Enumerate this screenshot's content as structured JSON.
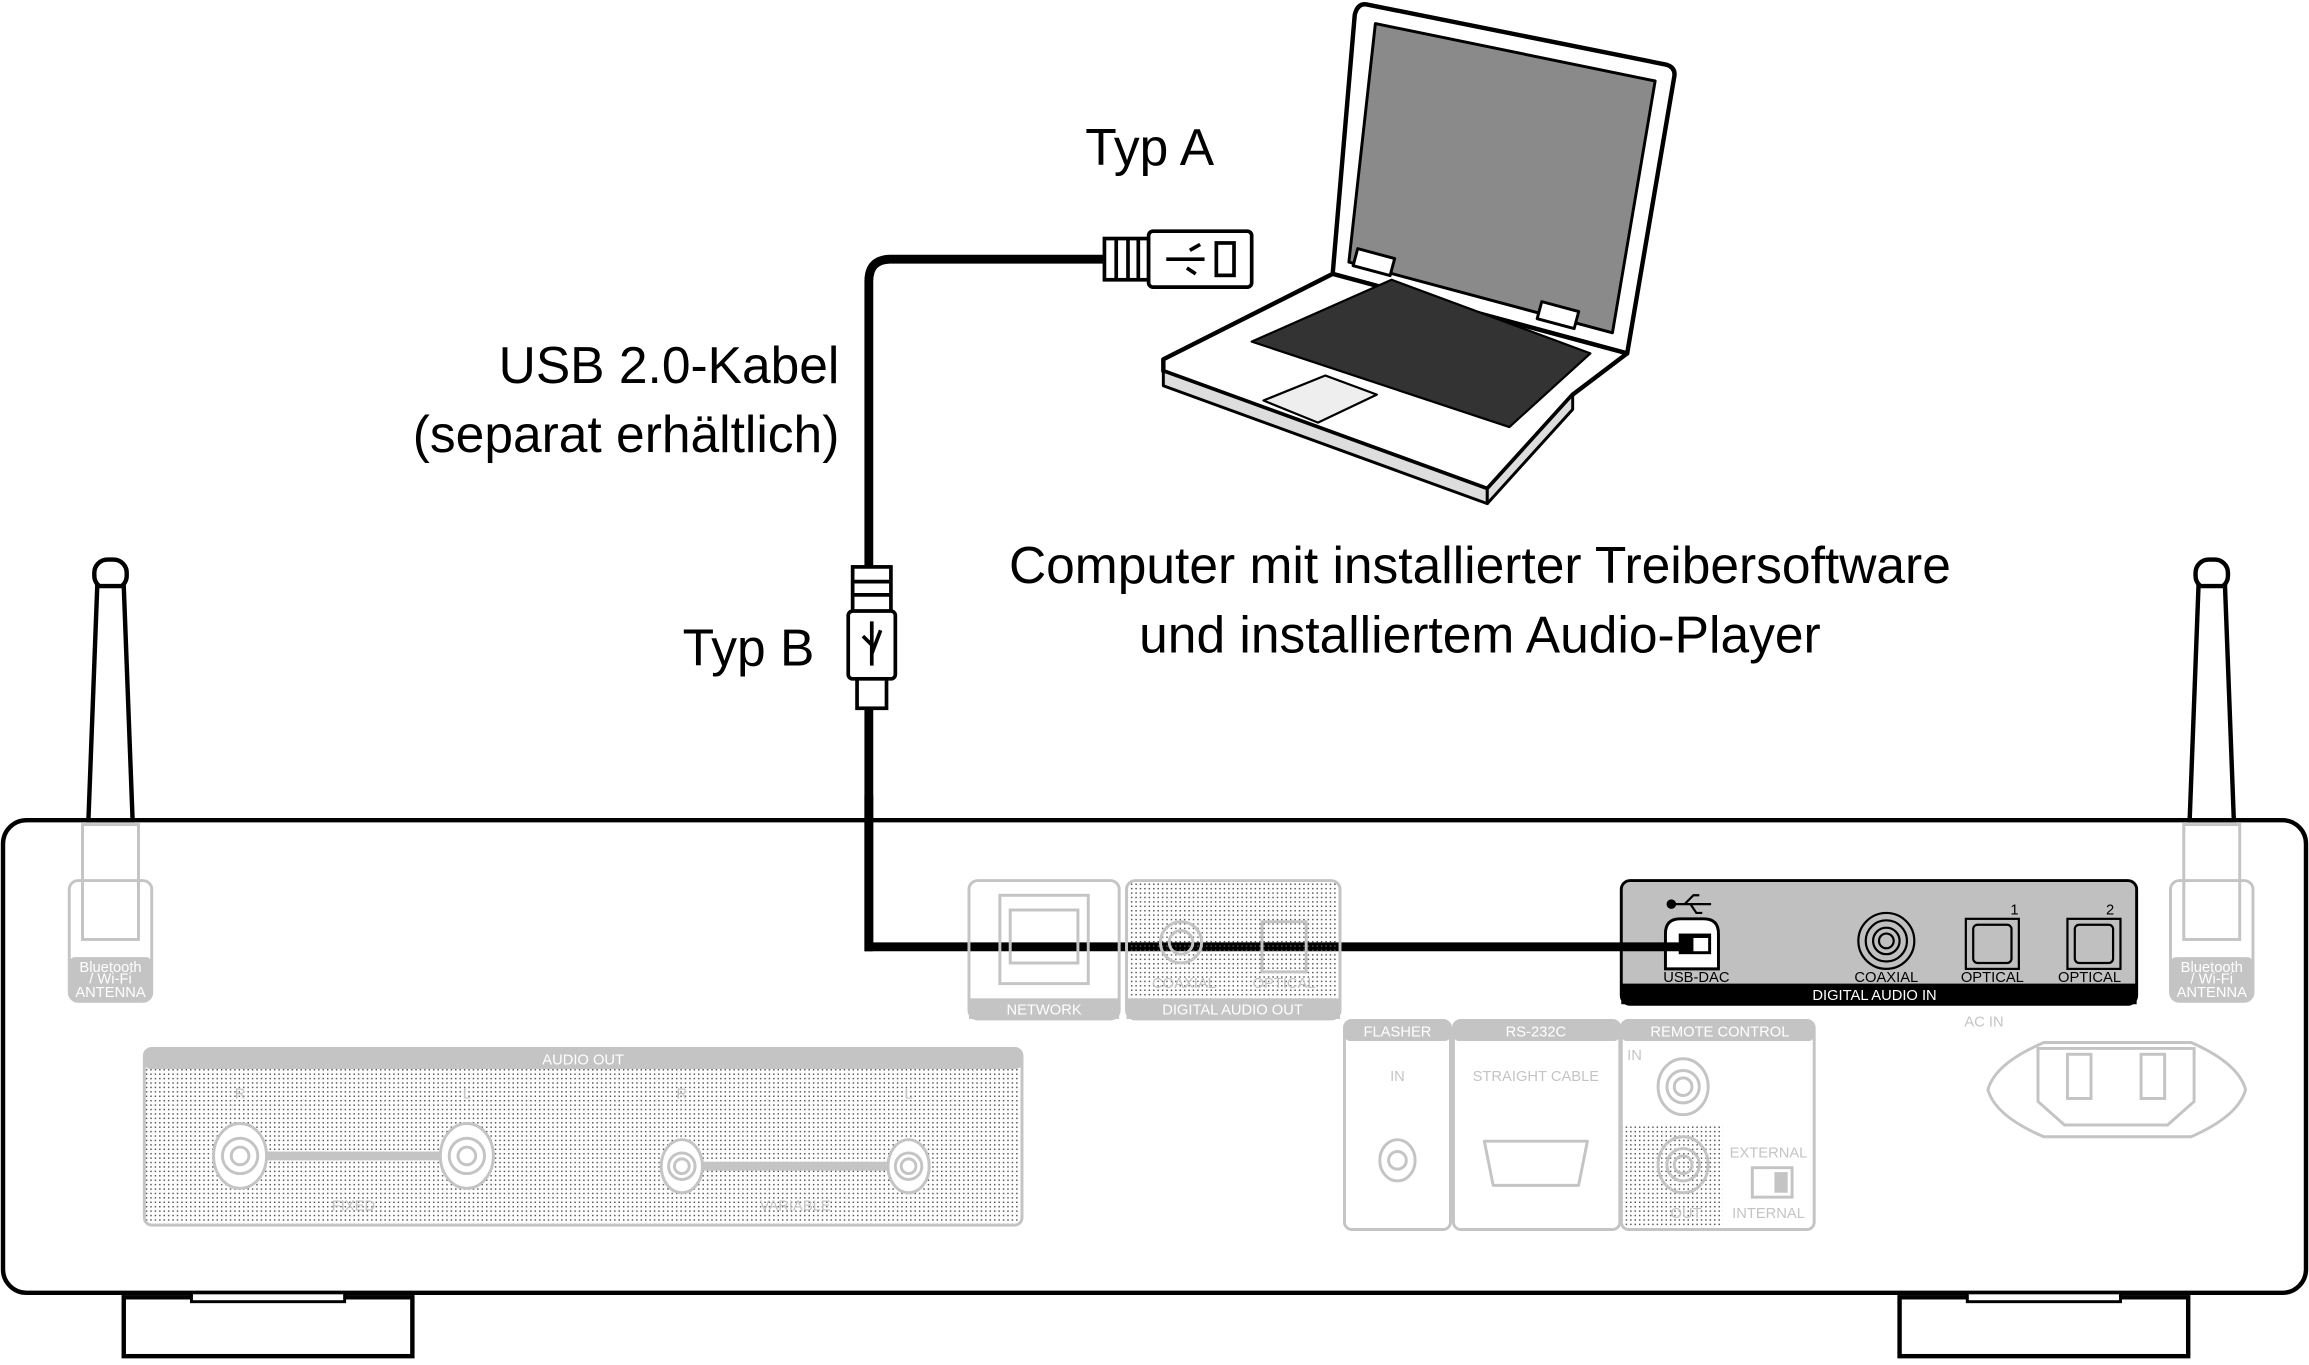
{
  "labels": {
    "typ_a": "Typ A",
    "typ_b": "Typ B",
    "cable_line1": "USB 2.0-Kabel",
    "cable_line2": "(separat erhältlich)",
    "computer_line1": "Computer mit installierter Treibersoftware",
    "computer_line2": "und installiertem Audio-Player"
  },
  "panel": {
    "antenna": [
      "Bluetooth",
      "/ Wi-Fi",
      "ANTENNA"
    ],
    "network": "NETWORK",
    "digital_audio_out": {
      "title": "DIGITAL AUDIO OUT",
      "coaxial": "COAXIAL",
      "optical": "OPTICAL"
    },
    "digital_audio_in": {
      "title": "DIGITAL AUDIO IN",
      "usb_dac": "USB-DAC",
      "coaxial": "COAXIAL",
      "optical1": "OPTICAL",
      "optical2": "OPTICAL",
      "num1": "1",
      "num2": "2"
    },
    "audio_out": {
      "title": "AUDIO OUT",
      "r": "R",
      "l": "L",
      "fixed": "FIXED",
      "variable": "VARIABLE"
    },
    "flasher": {
      "title": "FLASHER",
      "in": "IN"
    },
    "rs232c": {
      "title": "RS-232C",
      "sub": "STRAIGHT CABLE"
    },
    "remote_control": {
      "title": "REMOTE CONTROL",
      "in": "IN",
      "out": "OUT",
      "external": "EXTERNAL",
      "internal": "INTERNAL"
    },
    "ac_in": "AC IN"
  },
  "colors": {
    "line": "#000000",
    "panel_gray": "#c4c4c4",
    "digital_in_bg": "#c0c0c0"
  }
}
